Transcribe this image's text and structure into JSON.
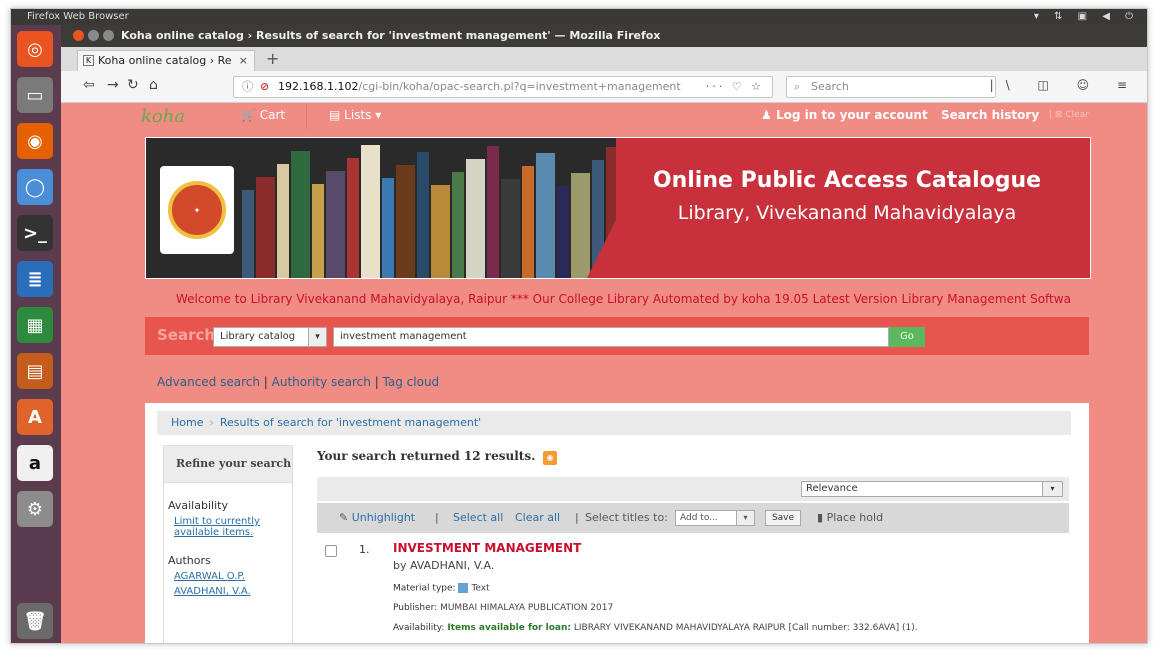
{
  "os": {
    "topbar_title": "Firefox Web Browser",
    "launcher": [
      {
        "name": "ubuntu-logo",
        "glyph": "◎",
        "color": "#e95420"
      },
      {
        "name": "files",
        "glyph": "▭",
        "color": "#7a7a7a"
      },
      {
        "name": "firefox",
        "glyph": "◉",
        "color": "#e66000"
      },
      {
        "name": "chromium",
        "glyph": "◯",
        "color": "#4a8ed8"
      },
      {
        "name": "terminal",
        "glyph": ">_",
        "color": "#333333"
      },
      {
        "name": "writer",
        "glyph": "≣",
        "color": "#2a6ebb"
      },
      {
        "name": "calc",
        "glyph": "▦",
        "color": "#2e8b3e"
      },
      {
        "name": "impress",
        "glyph": "▤",
        "color": "#c35c1c"
      },
      {
        "name": "software-center",
        "glyph": "A",
        "color": "#e0642a"
      },
      {
        "name": "amazon",
        "glyph": "a",
        "color": "#f0f0f0"
      },
      {
        "name": "settings",
        "glyph": "⚙",
        "color": "#8c8c8c"
      },
      {
        "name": "trash",
        "glyph": "🗑",
        "color": "#6a6a6a"
      }
    ]
  },
  "browser": {
    "window_title": "Koha online catalog › Results of search for 'investment management' — Mozilla Firefox",
    "tab_label": "Koha online catalog › Re",
    "url_host": "192.168.1.102",
    "url_path": "/cgi-bin/koha/opac-search.pl?q=investment+management",
    "search_placeholder": "Search"
  },
  "koha": {
    "logo": "koha",
    "cart": "Cart",
    "lists": "Lists",
    "login": "Log in to your account",
    "search_history": "Search history",
    "clear": "Clear"
  },
  "banner": {
    "title": "Online Public Access Catalogue",
    "subtitle": "Library, Vivekanand Mahavidyalaya"
  },
  "marquee": "Welcome to Library Vivekanand Mahavidyalaya, Raipur *** Our College Library Automated by koha 19.05 Latest Version Library Management Softwa",
  "search": {
    "label": "Search",
    "catalog": "Library catalog",
    "query": "investment management",
    "go": "Go"
  },
  "links": {
    "advanced": "Advanced search",
    "authority": "Authority search",
    "tagcloud": "Tag cloud"
  },
  "breadcrumb": {
    "home": "Home",
    "current": "Results of search for 'investment management'"
  },
  "refine": {
    "heading": "Refine your search",
    "availability": "Availability",
    "limit": "Limit to currently available items.",
    "authors": "Authors",
    "author1": "AGARWAL O.P.",
    "author2": "AVADHANI, V.A."
  },
  "results": {
    "summary": "Your search returned 12 results.",
    "sort": "Relevance",
    "unhighlight": "Unhighlight",
    "select_all": "Select all",
    "clear_all": "Clear all",
    "select_titles": "Select titles to:",
    "add_to": "Add to...",
    "save": "Save",
    "place_hold": "Place hold",
    "item": {
      "number": "1.",
      "title": "INVESTMENT MANAGEMENT",
      "author": "by AVADHANI, V.A.",
      "material_label": "Material type:",
      "material": "Text",
      "publisher_label": "Publisher:",
      "publisher": "MUMBAI HIMALAYA PUBLICATION 2017",
      "availability_label": "Availability:",
      "availability": "Items available for loan:",
      "availability_detail": "LIBRARY VIVEKANAND MAHAVIDYALAYA RAIPUR [Call number: 332.6AVA] (1)."
    }
  }
}
